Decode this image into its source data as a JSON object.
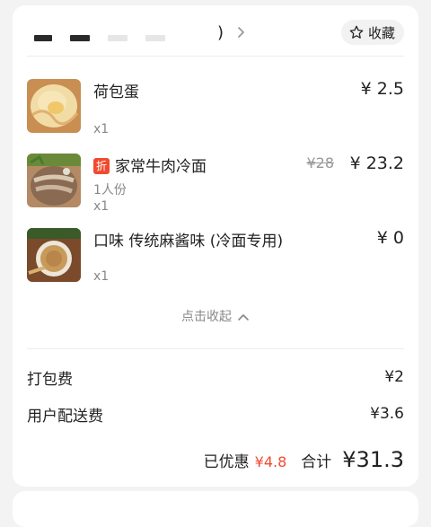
{
  "header": {
    "shop_suffix": ")",
    "favorite_label": "收藏"
  },
  "items": [
    {
      "name": "荷包蛋",
      "spec": "",
      "qty": "x1",
      "price": "¥ 2.5",
      "orig_price": ""
    },
    {
      "name": "家常牛肉冷面",
      "tag": "折",
      "spec": "1人份",
      "qty": "x1",
      "price": "¥ 23.2",
      "orig_price": "¥28"
    },
    {
      "name": "口味  传统麻酱味 (冷面专用)",
      "spec": "",
      "qty": "x1",
      "price": "¥ 0",
      "orig_price": ""
    }
  ],
  "collapse_label": "点击收起",
  "fees": [
    {
      "label": "打包费",
      "value": "¥2"
    },
    {
      "label": "用户配送费",
      "value": "¥3.6"
    }
  ],
  "summary": {
    "discount_label": "已优惠",
    "discount_value": "¥4.8",
    "total_label": "合计",
    "total_value": "¥31.3"
  },
  "colors": {
    "accent_red": "#f04a2f",
    "text_primary": "#222222",
    "text_secondary": "#888888"
  },
  "icons": {
    "favorite": "star-outline-icon",
    "shop_link": "chevron-right-icon",
    "collapse": "chevron-up-icon"
  }
}
